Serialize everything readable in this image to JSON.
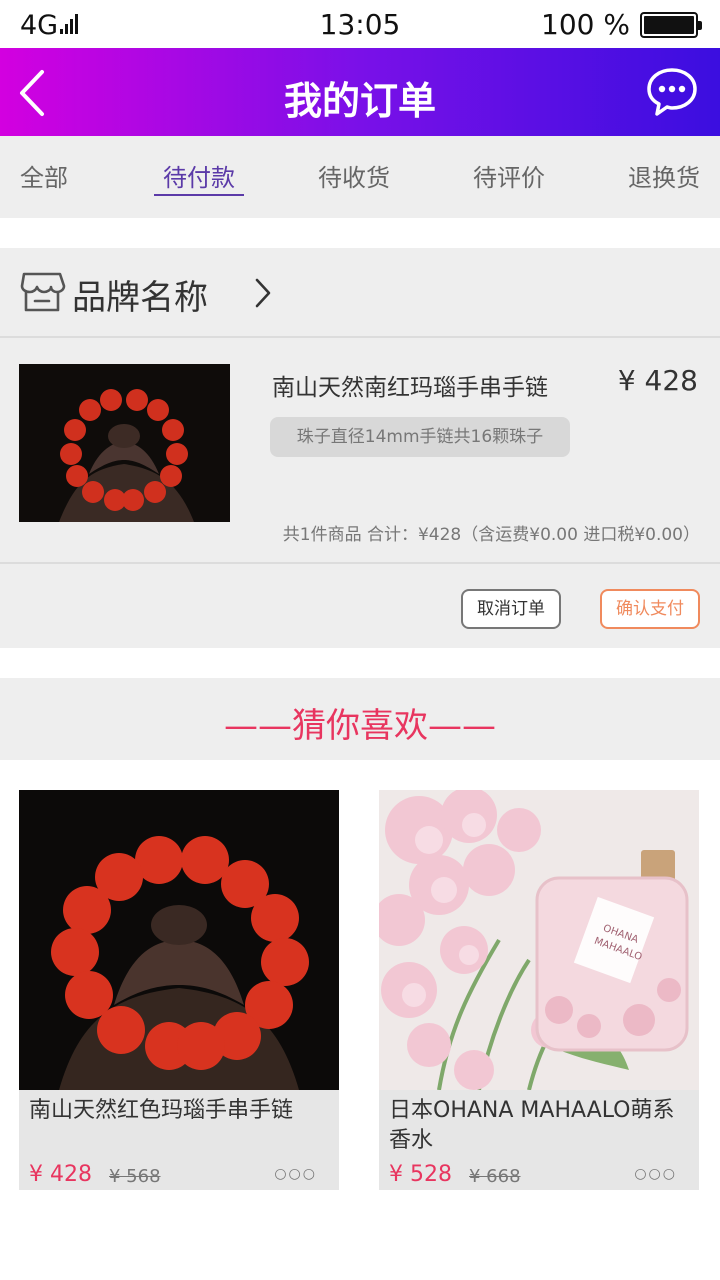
{
  "status_bar": {
    "network": "4G",
    "time": "13:05",
    "battery": "100 %"
  },
  "header": {
    "title": "我的订单",
    "back_icon": "chevron-left-icon",
    "chat_icon": "chat-bubble-icon",
    "gradient": [
      "#d300e0",
      "#3b0ee0"
    ]
  },
  "tabs": [
    {
      "label": "全部",
      "active": false
    },
    {
      "label": "待付款",
      "active": true
    },
    {
      "label": "待收货",
      "active": false
    },
    {
      "label": "待评价",
      "active": false
    },
    {
      "label": "退换货",
      "active": false
    }
  ],
  "order": {
    "store_name": "品牌名称",
    "store_icon": "store-icon",
    "product": {
      "title": "南山天然南红玛瑙手串手链",
      "price": "¥ 428",
      "spec": "珠子直径14mm手链共16颗珠子"
    },
    "summary": "共1件商品  合计：¥428（含运费¥0.00 进口税¥0.00）",
    "cancel_label": "取消订单",
    "pay_label": "确认支付"
  },
  "recommend": {
    "title": "——猜你喜欢——",
    "items": [
      {
        "title": "南山天然红色玛瑙手串手链",
        "price": "¥ 428",
        "old_price": "¥ 568",
        "more": "○○○"
      },
      {
        "title": "日本OHANA MAHAALO萌系香水",
        "price": "¥ 528",
        "old_price": "¥ 668",
        "more": "○○○"
      }
    ]
  },
  "colors": {
    "accent": "#e8355f",
    "tab_active": "#5b3aa8",
    "pay_button": "#f08a5d"
  }
}
